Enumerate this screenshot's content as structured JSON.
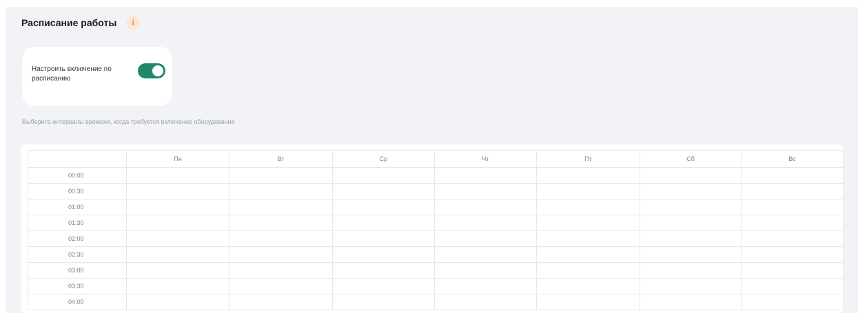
{
  "header": {
    "title": "Расписание работы",
    "info_icon": "info-icon"
  },
  "schedule_card": {
    "toggle_label": "Настроить включение по расписанию",
    "toggle_on": true
  },
  "hint": "Выберите интервалы времени, когда требуется включение оборудования",
  "table": {
    "days": [
      "Пн",
      "Вт",
      "Ср",
      "Чт",
      "Пт",
      "Сб",
      "Вс"
    ],
    "times": [
      "00:00",
      "00:30",
      "01:00",
      "01:30",
      "02:00",
      "02:30",
      "03:00",
      "03:30",
      "04:00"
    ]
  },
  "colors": {
    "accent": "#1f8a6b",
    "background": "#f2f3f7",
    "info": "#f08a4b"
  }
}
